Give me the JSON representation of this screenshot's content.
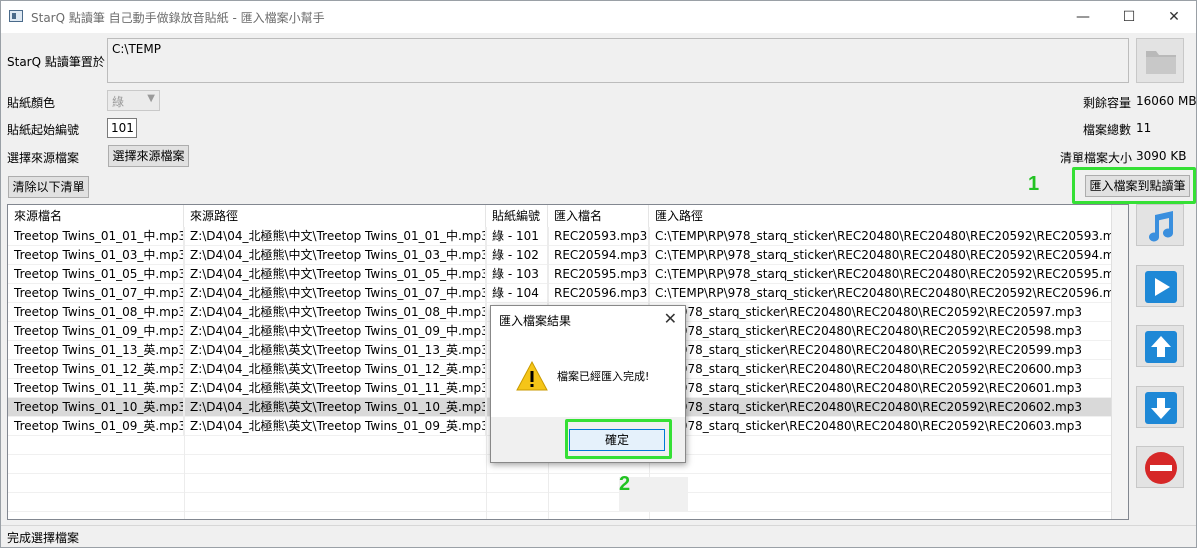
{
  "window": {
    "title": "StarQ 點讀筆 自己動手做錄放音貼紙 - 匯入檔案小幫手",
    "minimize": "—",
    "maximize": "☐",
    "close": "✕"
  },
  "form": {
    "pen_location_label": "StarQ 點讀筆置於",
    "pen_location_value": "C:\\TEMP",
    "sticker_color_label": "貼紙顏色",
    "sticker_color_value": "綠",
    "sticker_start_label": "貼紙起始編號",
    "sticker_start_value": "101",
    "source_file_label": "選擇來源檔案",
    "source_file_button": "選擇來源檔案",
    "clear_button": "清除以下清單",
    "import_button": "匯入檔案到點讀筆",
    "free_space_label": "剩餘容量",
    "free_space_value": "16060 MB",
    "file_count_label": "檔案總數",
    "file_count_value": "11",
    "list_size_label": "清單檔案大小",
    "list_size_value": "3090 KB"
  },
  "annotations": {
    "one": "1",
    "two": "2"
  },
  "table": {
    "headers": [
      "來源檔名",
      "來源路徑",
      "貼紙編號",
      "匯入檔名",
      "匯入路徑"
    ],
    "rows": [
      [
        "Treetop Twins_01_01_中.mp3",
        "Z:\\D4\\04_北極熊\\中文\\Treetop Twins_01_01_中.mp3",
        "綠 - 101",
        "REC20593.mp3",
        "C:\\TEMP\\RP\\978_starq_sticker\\REC20480\\REC20480\\REC20592\\REC20593.mp3"
      ],
      [
        "Treetop Twins_01_03_中.mp3",
        "Z:\\D4\\04_北極熊\\中文\\Treetop Twins_01_03_中.mp3",
        "綠 - 102",
        "REC20594.mp3",
        "C:\\TEMP\\RP\\978_starq_sticker\\REC20480\\REC20480\\REC20592\\REC20594.mp3"
      ],
      [
        "Treetop Twins_01_05_中.mp3",
        "Z:\\D4\\04_北極熊\\中文\\Treetop Twins_01_05_中.mp3",
        "綠 - 103",
        "REC20595.mp3",
        "C:\\TEMP\\RP\\978_starq_sticker\\REC20480\\REC20480\\REC20592\\REC20595.mp3"
      ],
      [
        "Treetop Twins_01_07_中.mp3",
        "Z:\\D4\\04_北極熊\\中文\\Treetop Twins_01_07_中.mp3",
        "綠 - 104",
        "REC20596.mp3",
        "C:\\TEMP\\RP\\978_starq_sticker\\REC20480\\REC20480\\REC20592\\REC20596.mp3"
      ],
      [
        "Treetop Twins_01_08_中.mp3",
        "Z:\\D4\\04_北極熊\\中文\\Treetop Twins_01_08_中.mp3",
        "",
        "",
        "P\\RP\\978_starq_sticker\\REC20480\\REC20480\\REC20592\\REC20597.mp3"
      ],
      [
        "Treetop Twins_01_09_中.mp3",
        "Z:\\D4\\04_北極熊\\中文\\Treetop Twins_01_09_中.mp3",
        "",
        "",
        "P\\RP\\978_starq_sticker\\REC20480\\REC20480\\REC20592\\REC20598.mp3"
      ],
      [
        "Treetop Twins_01_13_英.mp3",
        "Z:\\D4\\04_北極熊\\英文\\Treetop Twins_01_13_英.mp3",
        "",
        "",
        "P\\RP\\978_starq_sticker\\REC20480\\REC20480\\REC20592\\REC20599.mp3"
      ],
      [
        "Treetop Twins_01_12_英.mp3",
        "Z:\\D4\\04_北極熊\\英文\\Treetop Twins_01_12_英.mp3",
        "",
        "",
        "P\\RP\\978_starq_sticker\\REC20480\\REC20480\\REC20592\\REC20600.mp3"
      ],
      [
        "Treetop Twins_01_11_英.mp3",
        "Z:\\D4\\04_北極熊\\英文\\Treetop Twins_01_11_英.mp3",
        "",
        "",
        "P\\RP\\978_starq_sticker\\REC20480\\REC20480\\REC20592\\REC20601.mp3"
      ],
      [
        "Treetop Twins_01_10_英.mp3",
        "Z:\\D4\\04_北極熊\\英文\\Treetop Twins_01_10_英.mp3",
        "",
        "",
        "P\\RP\\978_starq_sticker\\REC20480\\REC20480\\REC20592\\REC20602.mp3"
      ],
      [
        "Treetop Twins_01_09_英.mp3",
        "Z:\\D4\\04_北極熊\\英文\\Treetop Twins_01_09_英.mp3",
        "",
        "",
        "P\\RP\\978_starq_sticker\\REC20480\\REC20480\\REC20592\\REC20603.mp3"
      ]
    ],
    "selected_row": 9
  },
  "dialog": {
    "title": "匯入檔案結果",
    "message": "檔案已經匯入完成!",
    "ok": "確定"
  },
  "status": "完成選擇檔案",
  "colors": {
    "highlight": "#35e035",
    "annotation": "#22c322",
    "play_blue": "#1e88d6",
    "stop_red": "#d62828"
  }
}
